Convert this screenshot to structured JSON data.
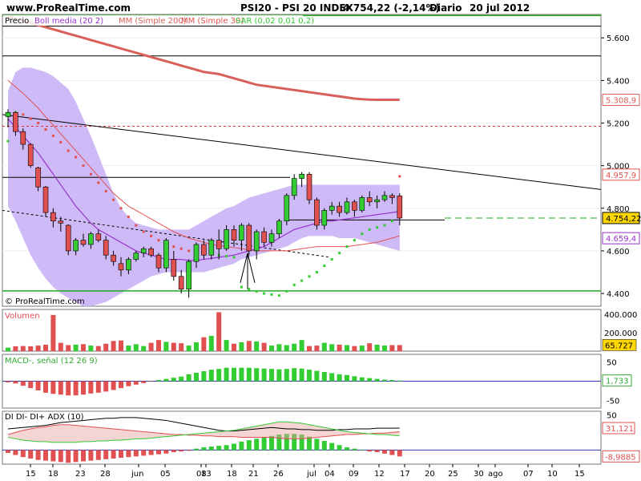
{
  "header": {
    "site": "www.ProRealTime.com",
    "symbol": "PSI20 - PSI 20 INDEX",
    "quote": "4.754,22 (-2,14%)",
    "period": "Diario",
    "date": "20 jul 2012"
  },
  "watermark": "© ProRealTime.com",
  "colors": {
    "up": "#33cc33",
    "down": "#e05050",
    "band": "#c9b3f5",
    "sma200": "#d9605a",
    "sma50": "#e05050",
    "sma20": "#9933cc",
    "support": "#22aa22",
    "resistance": "#e03030",
    "trend": "#000000",
    "axis_highlight": "#ffd700",
    "zero_line": "#3333aa"
  },
  "x_axis": {
    "labels": [
      "15",
      "18",
      "23",
      "28",
      "jun",
      "05",
      "08",
      "13",
      "18",
      "21",
      "26",
      "jul",
      "04",
      "09",
      "12",
      "17",
      "20",
      "25",
      "30",
      "ago",
      "07",
      "10",
      "15"
    ]
  },
  "chart_data": [
    {
      "type": "candlestick",
      "panel": "price",
      "legend": [
        "Precio",
        "Boll media (20 2)",
        "MM (Simple 200)",
        "MM (Simple 30)",
        "SAR (0,02 0,01 0,2)"
      ],
      "ylim": [
        4340,
        5710
      ],
      "yticks": [
        "5.600",
        "5.400",
        "5.200",
        "5.000",
        "4.800",
        "4.600",
        "4.400"
      ],
      "ytick_values": [
        5600,
        5400,
        5200,
        5000,
        4800,
        4600,
        4400
      ],
      "value_labels": [
        {
          "text": "5.308,9",
          "value": 5308.9,
          "color": "#d9605a",
          "fill": "#ffffff"
        },
        {
          "text": "4.957,9",
          "value": 4957.9,
          "color": "#e05050",
          "fill": "#ffffff"
        },
        {
          "text": "4.754,22",
          "value": 4754.22,
          "color": "#000000",
          "fill": "#ffd700"
        },
        {
          "text": "4.659,4",
          "value": 4659.4,
          "color": "#9933cc",
          "fill": "#ffffff"
        }
      ],
      "ohlc": [
        [
          5230,
          5265,
          5180,
          5250
        ],
        [
          5250,
          5255,
          5140,
          5160
        ],
        [
          5160,
          5175,
          5075,
          5100
        ],
        [
          5100,
          5105,
          4990,
          5000
        ],
        [
          4990,
          4995,
          4880,
          4900
        ],
        [
          4900,
          4905,
          4760,
          4780
        ],
        [
          4780,
          4800,
          4710,
          4740
        ],
        [
          4740,
          4760,
          4690,
          4730
        ],
        [
          4720,
          4725,
          4580,
          4600
        ],
        [
          4600,
          4660,
          4580,
          4650
        ],
        [
          4650,
          4680,
          4620,
          4630
        ],
        [
          4630,
          4690,
          4610,
          4680
        ],
        [
          4680,
          4700,
          4640,
          4650
        ],
        [
          4650,
          4670,
          4560,
          4580
        ],
        [
          4580,
          4600,
          4530,
          4550
        ],
        [
          4540,
          4570,
          4480,
          4510
        ],
        [
          4510,
          4570,
          4490,
          4560
        ],
        [
          4560,
          4600,
          4550,
          4590
        ],
        [
          4590,
          4620,
          4570,
          4610
        ],
        [
          4610,
          4620,
          4570,
          4580
        ],
        [
          4580,
          4590,
          4500,
          4520
        ],
        [
          4520,
          4660,
          4500,
          4650
        ],
        [
          4560,
          4600,
          4460,
          4480
        ],
        [
          4480,
          4510,
          4400,
          4420
        ],
        [
          4420,
          4560,
          4380,
          4550
        ],
        [
          4550,
          4640,
          4520,
          4630
        ],
        [
          4630,
          4650,
          4560,
          4580
        ],
        [
          4580,
          4660,
          4560,
          4650
        ],
        [
          4650,
          4700,
          4560,
          4610
        ],
        [
          4610,
          4720,
          4600,
          4700
        ],
        [
          4700,
          4720,
          4620,
          4650
        ],
        [
          4650,
          4730,
          4600,
          4720
        ],
        [
          4720,
          4730,
          4580,
          4600
        ],
        [
          4600,
          4700,
          4560,
          4690
        ],
        [
          4690,
          4710,
          4620,
          4640
        ],
        [
          4640,
          4700,
          4620,
          4680
        ],
        [
          4680,
          4750,
          4660,
          4740
        ],
        [
          4740,
          4870,
          4720,
          4860
        ],
        [
          4860,
          4960,
          4840,
          4940
        ],
        [
          4940,
          4970,
          4900,
          4960
        ],
        [
          4960,
          4970,
          4820,
          4840
        ],
        [
          4840,
          4850,
          4700,
          4720
        ],
        [
          4720,
          4800,
          4700,
          4790
        ],
        [
          4790,
          4830,
          4770,
          4810
        ],
        [
          4810,
          4830,
          4760,
          4780
        ],
        [
          4780,
          4850,
          4770,
          4830
        ],
        [
          4830,
          4840,
          4760,
          4790
        ],
        [
          4790,
          4860,
          4780,
          4850
        ],
        [
          4850,
          4880,
          4810,
          4830
        ],
        [
          4830,
          4860,
          4800,
          4840
        ],
        [
          4840,
          4880,
          4830,
          4860
        ],
        [
          4860,
          4870,
          4820,
          4850
        ],
        [
          4858,
          4870,
          4720,
          4754
        ]
      ],
      "band_upper": [
        5350,
        5440,
        5460,
        5460,
        5450,
        5440,
        5420,
        5390,
        5360,
        5300,
        5220,
        5140,
        5050,
        4960,
        4870,
        4800,
        4760,
        4730,
        4720,
        4710,
        4700,
        4700,
        4700,
        4700,
        4700,
        4720,
        4740,
        4760,
        4780,
        4800,
        4810,
        4830,
        4850,
        4860,
        4870,
        4880,
        4890,
        4900,
        4910,
        4910,
        4910,
        4910,
        4910,
        4910,
        4910,
        4910,
        4910,
        4910,
        4910,
        4910,
        4910,
        4910,
        4910
      ],
      "band_lower": [
        4810,
        4740,
        4660,
        4580,
        4520,
        4470,
        4430,
        4400,
        4380,
        4360,
        4340,
        4340,
        4350,
        4360,
        4380,
        4400,
        4420,
        4440,
        4460,
        4480,
        4490,
        4500,
        4500,
        4500,
        4500,
        4500,
        4500,
        4510,
        4520,
        4530,
        4540,
        4560,
        4570,
        4580,
        4590,
        4600,
        4610,
        4620,
        4640,
        4660,
        4670,
        4670,
        4670,
        4670,
        4660,
        4660,
        4660,
        4650,
        4640,
        4630,
        4620,
        4610,
        4600
      ],
      "sma20": [
        5220,
        5180,
        5140,
        5100,
        5060,
        5010,
        4960,
        4910,
        4860,
        4810,
        4770,
        4730,
        4700,
        4680,
        4660,
        4640,
        4620,
        4600,
        4590,
        4580,
        4570,
        4560,
        4560,
        4560,
        4555,
        4555,
        4560,
        4565,
        4570,
        4575,
        4580,
        4590,
        4600,
        4610,
        4620,
        4640,
        4660,
        4680,
        4700,
        4710,
        4720,
        4730,
        4740,
        4740,
        4745,
        4750,
        4755,
        4760,
        4765,
        4770,
        4775,
        4780,
        4785
      ],
      "sma50": [
        5400,
        5370,
        5340,
        5305,
        5270,
        5230,
        5190,
        5150,
        5110,
        5070,
        5030,
        4990,
        4950,
        4910,
        4870,
        4840,
        4810,
        4790,
        4770,
        4750,
        4730,
        4710,
        4690,
        4675,
        4660,
        4650,
        4640,
        4630,
        4625,
        4620,
        4615,
        4610,
        4605,
        4600,
        4600,
        4600,
        4600,
        4600,
        4605,
        4610,
        4615,
        4620,
        4620,
        4620,
        4620,
        4620,
        4625,
        4630,
        4635,
        4640,
        4650,
        4660,
        4670
      ],
      "sma200": [
        5700,
        5690,
        5680,
        5670,
        5660,
        5650,
        5640,
        5630,
        5620,
        5610,
        5600,
        5590,
        5580,
        5570,
        5560,
        5550,
        5540,
        5530,
        5520,
        5510,
        5500,
        5490,
        5480,
        5470,
        5460,
        5450,
        5440,
        5435,
        5430,
        5420,
        5410,
        5400,
        5390,
        5380,
        5375,
        5370,
        5365,
        5360,
        5355,
        5350,
        5345,
        5340,
        5335,
        5330,
        5325,
        5320,
        5315,
        5312,
        5310,
        5309,
        5309,
        5309,
        5309
      ],
      "sar": [
        5115,
        5250,
        5240,
        5220,
        5200,
        5170,
        5140,
        5110,
        5070,
        5040,
        5000,
        4960,
        4920,
        4880,
        4840,
        4800,
        4760,
        4720,
        4690,
        4670,
        4650,
        4630,
        4620,
        4610,
        4600,
        4595,
        4590,
        4585,
        4580,
        4575,
        4570,
        4430,
        4420,
        4410,
        4400,
        4395,
        4390,
        4410,
        4440,
        4460,
        4480,
        4500,
        4530,
        4560,
        4590,
        4620,
        4650,
        4680,
        4700,
        4710,
        4720,
        4740,
        4950
      ]
    },
    {
      "type": "bar",
      "panel": "volume",
      "title": "Volumen",
      "ylim": [
        0,
        450000
      ],
      "yticks": [
        "400.000",
        "200.000"
      ],
      "ytick_values": [
        400000,
        200000
      ],
      "last_label": "65.727",
      "values": [
        38000,
        52000,
        55000,
        52000,
        60000,
        70000,
        390000,
        90000,
        65000,
        70000,
        75000,
        60000,
        55000,
        80000,
        110000,
        115000,
        60000,
        75000,
        55000,
        90000,
        120000,
        100000,
        90000,
        85000,
        60000,
        95000,
        150000,
        165000,
        420000,
        120000,
        80000,
        95000,
        110000,
        105000,
        90000,
        60000,
        75000,
        65000,
        80000,
        120000,
        55000,
        60000,
        90000,
        75000,
        70000,
        65000,
        55000,
        60000,
        85000,
        70000,
        60000,
        65000,
        65727
      ]
    },
    {
      "type": "bar",
      "panel": "macd",
      "title": "MACD-, señal (12 26 9)",
      "ylim": [
        -70,
        70
      ],
      "yticks": [
        "50",
        "-50"
      ],
      "ytick_values": [
        50,
        -50
      ],
      "last_label": "1,733",
      "values": [
        -3,
        -6,
        -12,
        -18,
        -24,
        -30,
        -33,
        -35,
        -37,
        -37,
        -35,
        -32,
        -30,
        -27,
        -23,
        -18,
        -13,
        -9,
        -5,
        -1,
        3,
        6,
        9,
        12,
        18,
        22,
        26,
        30,
        32,
        35,
        35,
        35,
        35,
        34,
        33,
        32,
        31,
        32,
        34,
        33,
        30,
        27,
        24,
        21,
        18,
        16,
        13,
        10,
        8,
        6,
        4,
        3,
        1.733
      ]
    },
    {
      "type": "line",
      "panel": "dmi",
      "title": "DI DI- DI+ ADX (10)",
      "ylim": [
        -20,
        55
      ],
      "yticks": [
        "50",
        "31,121",
        "-8,9885"
      ],
      "ytick_values": [
        50,
        31.121,
        -8.9885
      ],
      "adx_last_label": "31,121",
      "diff_last_label": "-8,9885",
      "series": [
        {
          "name": "ADX",
          "color": "#000000",
          "values": [
            30,
            31,
            32,
            33,
            34,
            35,
            37,
            39,
            40,
            41,
            42,
            43,
            44,
            45,
            45,
            46,
            46,
            46,
            45,
            44,
            43,
            42,
            40,
            38,
            36,
            34,
            32,
            30,
            28,
            27,
            27,
            28,
            29,
            30,
            31,
            32,
            31,
            30,
            30,
            29,
            29,
            28,
            28,
            28,
            29,
            29,
            30,
            30,
            30,
            31,
            31,
            31,
            31.121
          ]
        },
        {
          "name": "DI-",
          "color": "#e05050",
          "values": [
            22,
            25,
            28,
            30,
            32,
            33,
            35,
            36,
            36,
            35,
            34,
            33,
            32,
            31,
            30,
            29,
            28,
            27,
            26,
            25,
            24,
            23,
            22,
            22,
            21,
            21,
            20,
            20,
            19,
            19,
            19,
            18,
            18,
            18,
            18,
            18,
            17,
            16,
            16,
            16,
            17,
            18,
            19,
            20,
            21,
            22,
            22,
            23,
            23,
            24,
            24,
            25,
            26
          ]
        },
        {
          "name": "DI+",
          "color": "#33cc33",
          "values": [
            18,
            16,
            14,
            13,
            12,
            12,
            11,
            11,
            11,
            11,
            12,
            12,
            13,
            13,
            14,
            14,
            15,
            16,
            16,
            17,
            18,
            19,
            20,
            21,
            22,
            23,
            24,
            25,
            26,
            27,
            28,
            30,
            32,
            34,
            36,
            38,
            40,
            40,
            39,
            38,
            36,
            34,
            32,
            30,
            28,
            26,
            25,
            24,
            23,
            22,
            22,
            21,
            20
          ]
        }
      ],
      "diff_values": [
        -4,
        -7,
        -10,
        -12,
        -14,
        -15,
        -16,
        -17,
        -18,
        -17,
        -16,
        -15,
        -14,
        -13,
        -12,
        -11,
        -10,
        -9,
        -8,
        -7,
        -6,
        -5,
        -3,
        -2,
        -1,
        2,
        4,
        5,
        6,
        7,
        9,
        12,
        14,
        16,
        18,
        20,
        22,
        23,
        23,
        22,
        19,
        16,
        13,
        10,
        7,
        4,
        2,
        0,
        -2,
        -3,
        -5,
        -7,
        -8.9885
      ]
    }
  ]
}
